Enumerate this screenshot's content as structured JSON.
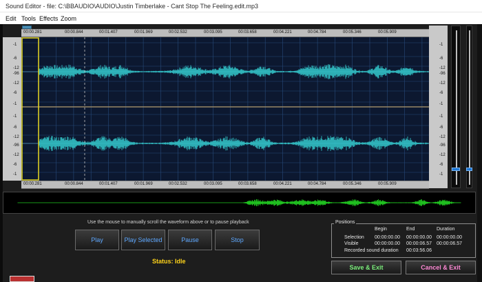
{
  "window": {
    "title": "Sound Editor - file: C:\\BBAUDIO\\AUDIO\\Justin Timberlake - Cant Stop The Feeling.edit.mp3"
  },
  "menu": [
    "Edit",
    "Tools",
    "Effects",
    "Zoom"
  ],
  "timeline": {
    "labels": [
      "00:00.281",
      "00:00.844",
      "00:01.407",
      "00:01.969",
      "00:02.532",
      "00:03.095",
      "00:03.658",
      "00:04.221",
      "00:04.784",
      "00:05.346",
      "00:05.909"
    ]
  },
  "scale_labels": {
    "channel1": [
      "-1",
      "-6",
      "-12",
      "-96",
      "-12",
      "-6",
      "-1"
    ],
    "channel2": [
      "-1",
      "-6",
      "-12",
      "-96",
      "-12",
      "-6",
      "-1"
    ]
  },
  "playback": {
    "hint": "Use the mouse to manually scroll the waveform above or to pause playback",
    "buttons": {
      "play": "Play",
      "play_selected": "Play Selected",
      "pause": "Pause",
      "stop": "Stop"
    },
    "status": "Status: Idle"
  },
  "positions": {
    "legend": "Positions",
    "col_begin": "Begin",
    "col_end": "End",
    "col_duration": "Duration",
    "selection_label": "Selection",
    "selection_begin": "00:00:00.00",
    "selection_end": "00:00:00.00",
    "selection_duration": "00:00:00.00",
    "visible_label": "Visible",
    "visible_begin": "00:00:00.00",
    "visible_end": "00:00:06.57",
    "visible_duration": "00:00:06.57",
    "recorded_label": "Recorded sound duration",
    "recorded_value": "00:03:56.06"
  },
  "actions": {
    "save": "Save & Exit",
    "cancel": "Cancel & Exit"
  },
  "colors": {
    "waveform": "#32c0c4",
    "overview_wave": "#22cc22",
    "grid": "#274a7a",
    "status": "#ffd31a",
    "selection": "#e8d820",
    "button_text": "#5ea8ff"
  }
}
